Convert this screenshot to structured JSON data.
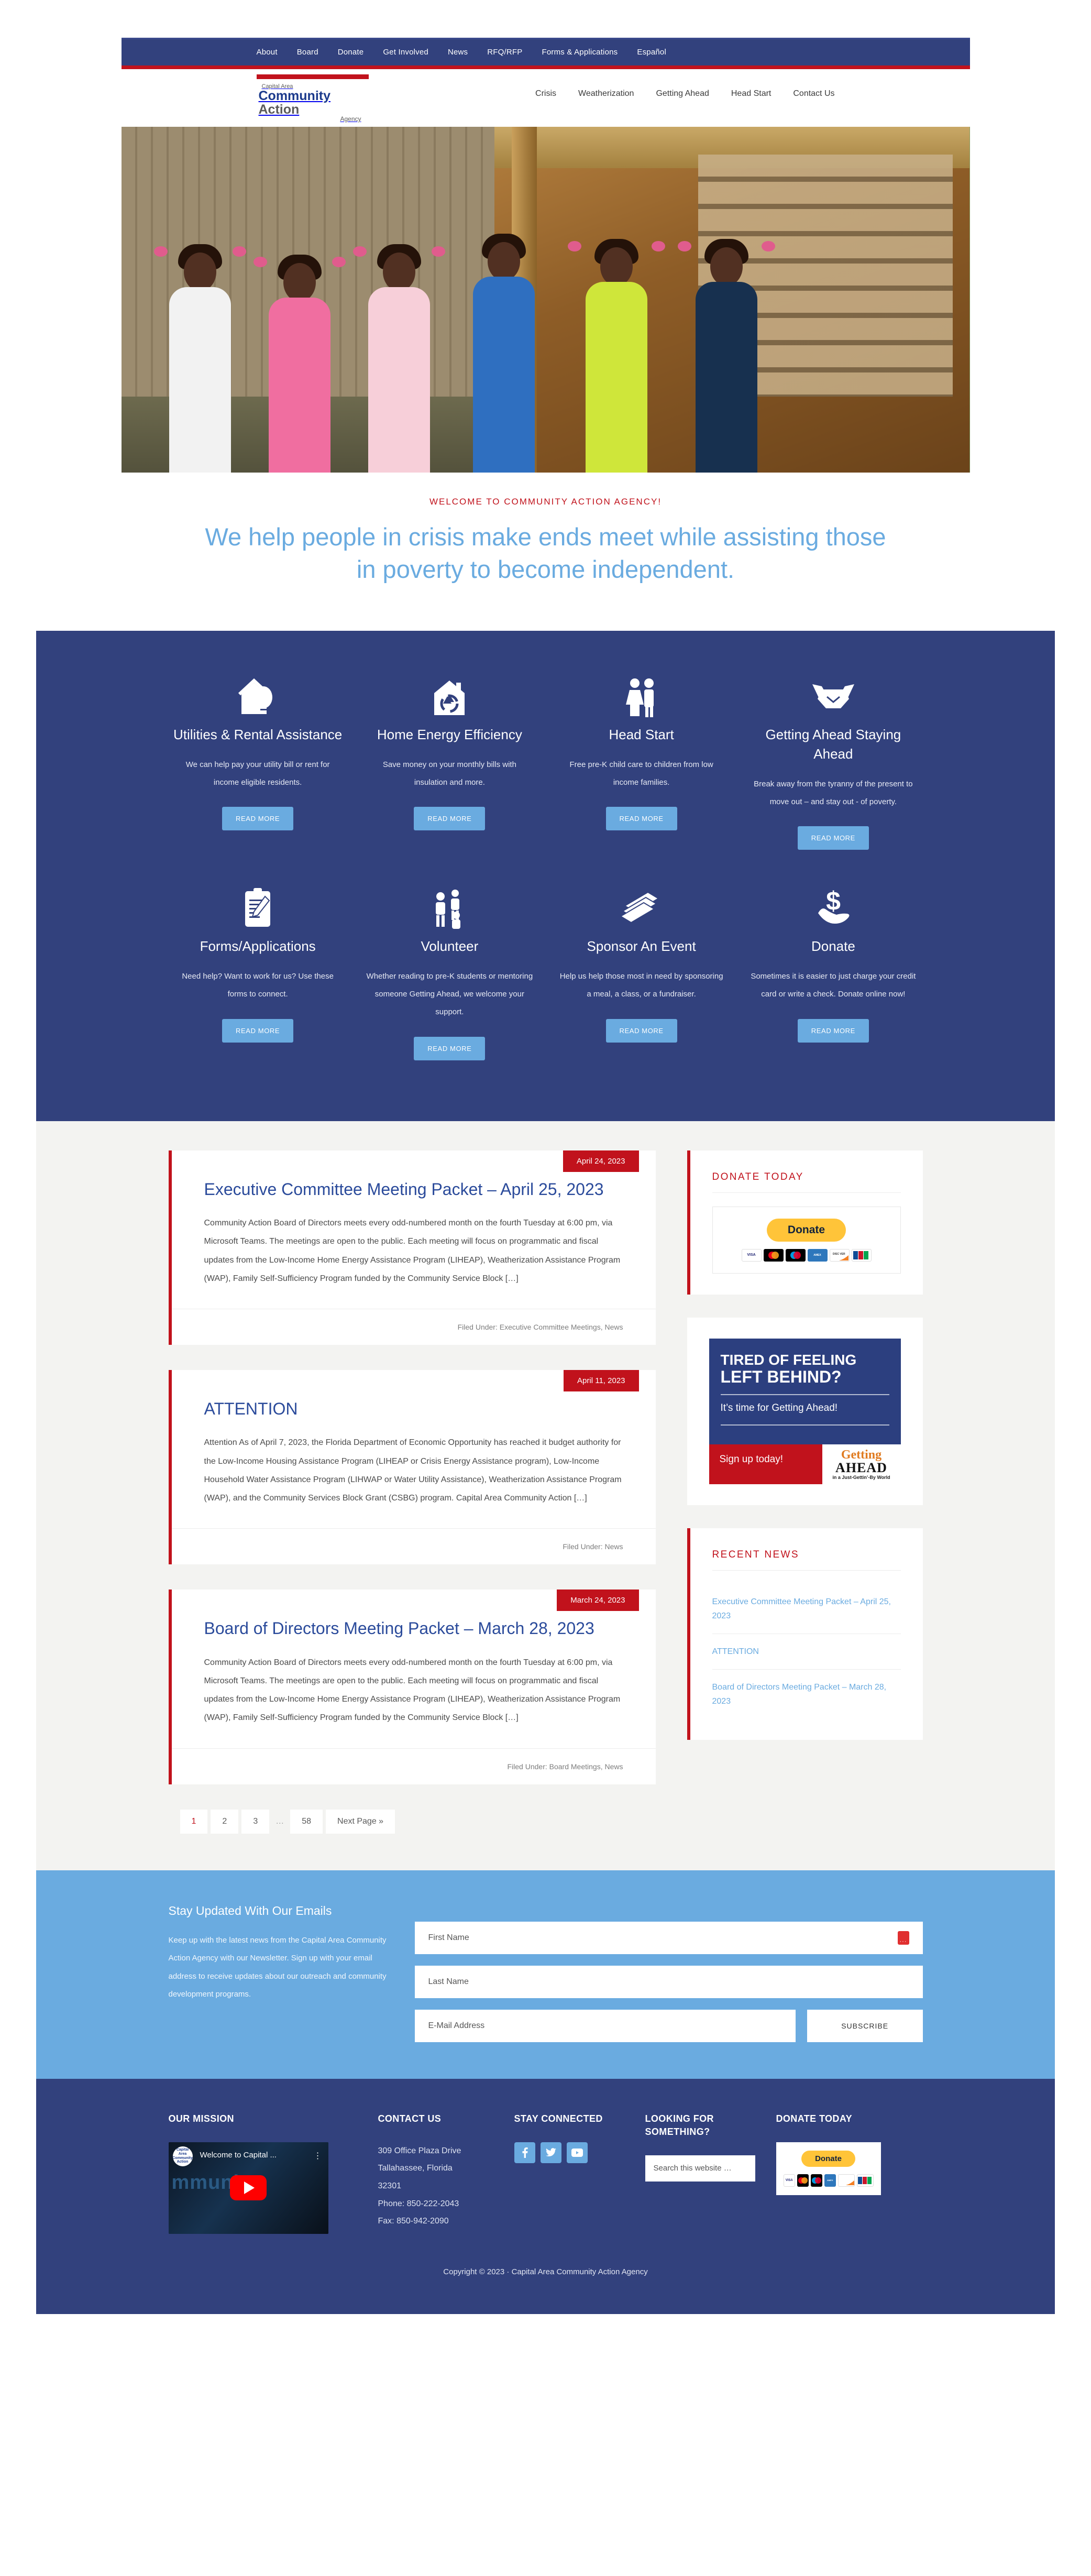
{
  "colors": {
    "navy": "#32417d",
    "red": "#c1121c",
    "light_blue": "#6aabe0",
    "paypal_yellow": "#ffc439",
    "page_bg": "#f3f3f1"
  },
  "topbar": {
    "items": [
      {
        "label": "About"
      },
      {
        "label": "Board"
      },
      {
        "label": "Donate"
      },
      {
        "label": "Get Involved"
      },
      {
        "label": "News"
      },
      {
        "label": "RFQ/RFP"
      },
      {
        "label": "Forms & Applications"
      },
      {
        "label": "Español"
      }
    ]
  },
  "logo": {
    "line1": "Capital Area",
    "word_blue": "Community",
    "word_gray": "Action",
    "line3": "Agency"
  },
  "mainnav": {
    "items": [
      {
        "label": "Crisis"
      },
      {
        "label": "Weatherization"
      },
      {
        "label": "Getting Ahead"
      },
      {
        "label": "Head Start"
      },
      {
        "label": "Contact Us"
      }
    ]
  },
  "welcome": {
    "kicker": "WELCOME TO COMMUNITY ACTION AGENCY!",
    "headline": "We help people in crisis make ends meet while assisting those in poverty to become independent."
  },
  "services": {
    "read_more_label": "READ MORE",
    "items": [
      {
        "icon": "house-lightbulb-icon",
        "title": "Utilities & Rental Assistance",
        "desc": "We can help pay your utility bill or rent for income eligible residents."
      },
      {
        "icon": "house-recycle-icon",
        "title": "Home Energy Efficiency",
        "desc": "Save money on your monthly bills with insulation and more."
      },
      {
        "icon": "two-children-icon",
        "title": "Head Start",
        "desc": "Free pre-K child care to children from low income families."
      },
      {
        "icon": "handshake-icon",
        "title": "Getting Ahead Staying Ahead",
        "desc": "Break away from the tyranny of the present to move out – and stay out - of poverty."
      },
      {
        "icon": "clipboard-pen-icon",
        "title": "Forms/Applications",
        "desc": "Need help? Want to work for us? Use these forms to connect."
      },
      {
        "icon": "people-group-icon",
        "title": "Volunteer",
        "desc": "Whether reading to pre-K students or mentoring someone Getting Ahead, we welcome your support."
      },
      {
        "icon": "tickets-icon",
        "title": "Sponsor An Event",
        "desc": "Help us help those most in need by sponsoring a meal, a class, or a fundraiser."
      },
      {
        "icon": "hand-dollar-icon",
        "title": "Donate",
        "desc": "Sometimes it is easier to just charge your credit card or write a check. Donate online now!"
      }
    ]
  },
  "posts": [
    {
      "date": "April 24, 2023",
      "title": "Executive Committee Meeting Packet – April 25, 2023",
      "excerpt": "Community Action Board of Directors meets every odd-numbered month on the fourth Tuesday at 6:00 pm, via Microsoft Teams. The meetings are open to the public. Each meeting will focus on programmatic and fiscal updates from the Low-Income Home Energy Assistance Program (LIHEAP), Weatherization Assistance Program (WAP), Family Self-Sufficiency Program funded by the Community Service Block […]",
      "filed_under": "Filed Under: Executive Committee Meetings, News"
    },
    {
      "date": "April 11, 2023",
      "title": "ATTENTION",
      "excerpt": "Attention As of April 7, 2023, the Florida Department of Economic Opportunity has reached it budget authority for the Low-Income Housing Assistance Program (LIHEAP or Crisis Energy Assistance program), Low-Income Household Water Assistance Program (LIHWAP or Water Utility Assistance), Weatherization Assistance Program (WAP), and the Community Services Block Grant (CSBG) program. Capital Area Community Action […]",
      "filed_under": "Filed Under: News"
    },
    {
      "date": "March 24, 2023",
      "title": "Board of Directors Meeting Packet – March 28, 2023",
      "excerpt": "Community Action Board of Directors meets every odd-numbered month on the fourth Tuesday at 6:00 pm, via Microsoft Teams. The meetings are open to the public. Each meeting will focus on programmatic and fiscal updates from the Low-Income Home Energy Assistance Program (LIHEAP), Weatherization Assistance Program (WAP), Family Self-Sufficiency Program funded by the Community Service Block […]",
      "filed_under": "Filed Under: Board Meetings, News"
    }
  ],
  "pagination": {
    "pages": [
      "1",
      "2",
      "3"
    ],
    "ellipsis": "…",
    "last": "58",
    "next_label": "Next Page »",
    "current": "1"
  },
  "sidebar": {
    "donate": {
      "title": "DONATE TODAY",
      "button_label": "Donate",
      "cards": [
        "VISA",
        "MC",
        "MAESTRO",
        "AMEX",
        "DISCOVER",
        "JCB"
      ]
    },
    "getting_ahead": {
      "line1": "TIRED OF FEELING",
      "line2": "LEFT BEHIND?",
      "line3": "It’s time for Getting Ahead!",
      "cta": "Sign up today!",
      "logo_top": "Getting",
      "logo_mid": "AHEAD",
      "logo_sub": "in a Just-Gettin’-By World"
    },
    "recent_news": {
      "title": "RECENT NEWS",
      "items": [
        "Executive Committee Meeting Packet – April 25, 2023",
        "ATTENTION",
        "Board of Directors Meeting Packet – March 28, 2023"
      ]
    }
  },
  "newsletter": {
    "heading": "Stay Updated With Our Emails",
    "text": "Keep up with the latest news from the Capital Area Community Action Agency with our Newsletter. Sign up with your email address to receive updates about our outreach and community development programs.",
    "first_name_placeholder": "First Name",
    "last_name_placeholder": "Last Name",
    "email_placeholder": "E-Mail Address",
    "submit_label": "SUBSCRIBE"
  },
  "footer": {
    "mission": {
      "title": "OUR MISSION",
      "video_title": "Welcome to Capital ..."
    },
    "contact": {
      "title": "CONTACT US",
      "address1": "309 Office Plaza Drive",
      "address2": "Tallahassee, Florida",
      "address3": "32301",
      "phone": "Phone: 850-222-2043",
      "fax": "Fax: 850-942-2090"
    },
    "connected": {
      "title": "STAY CONNECTED",
      "socials": [
        "facebook-icon",
        "twitter-icon",
        "youtube-icon"
      ]
    },
    "looking": {
      "title": "LOOKING FOR SOMETHING?",
      "search_placeholder": "Search this website …"
    },
    "donate": {
      "title": "DONATE TODAY",
      "button_label": "Donate"
    },
    "copyright": "Copyright © 2023 · Capital Area Community Action Agency"
  }
}
